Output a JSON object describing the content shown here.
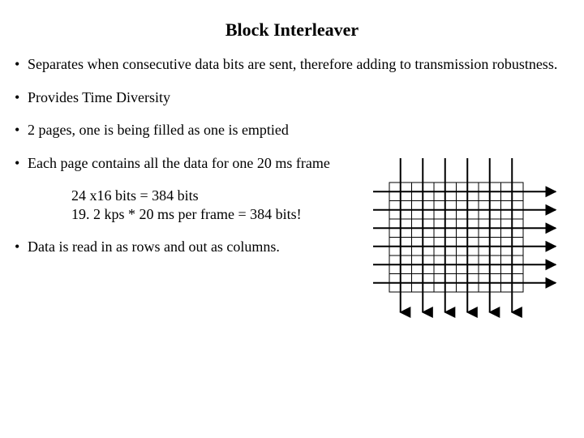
{
  "title": "Block Interleaver",
  "bullets": {
    "b1": "Separates when consecutive data bits are sent, therefore adding to transmission robustness.",
    "b2": "Provides Time Diversity",
    "b3": "2 pages, one is being filled as one is emptied",
    "b4": "Each page contains all the data for one 20 ms frame",
    "b5": "Data is read in as rows and out as columns."
  },
  "calc": {
    "line1": "24 x16 bits = 384 bits",
    "line2": "19. 2 kps * 20 ms per frame = 384 bits!"
  },
  "diagram": {
    "rows": 6,
    "cols": 6,
    "description": "grid with downward arrows entering top of each column and rightward arrows exiting each row"
  }
}
